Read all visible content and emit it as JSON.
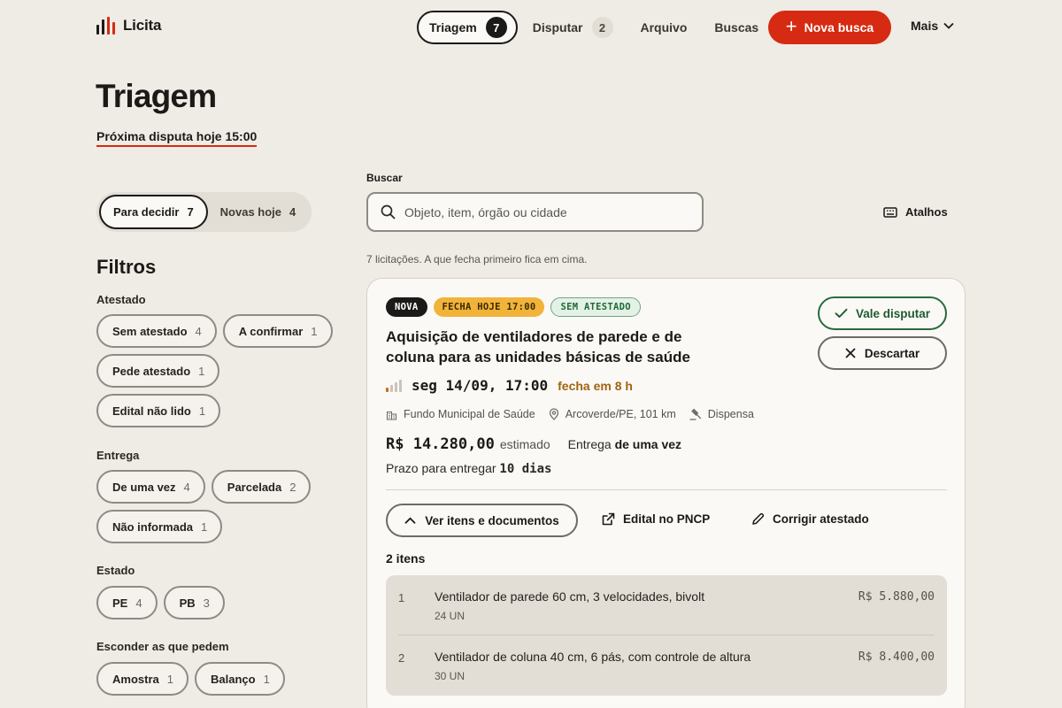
{
  "brand": {
    "name": "Licita",
    "icon": "bar-chart-icon"
  },
  "nav": {
    "items": [
      {
        "label": "Triagem",
        "count": "7",
        "active": true
      },
      {
        "label": "Disputar",
        "count": "2",
        "active": false
      },
      {
        "label": "Arquivo"
      },
      {
        "label": "Buscas"
      }
    ],
    "new_search": "Nova busca",
    "more": "Mais"
  },
  "page": {
    "title": "Triagem",
    "next_dispute": "Próxima disputa hoje 15:00"
  },
  "segment": [
    {
      "label": "Para decidir",
      "count": "7",
      "active": true
    },
    {
      "label": "Novas hoje",
      "count": "4",
      "active": false
    }
  ],
  "filters": {
    "title": "Filtros",
    "groups": [
      {
        "label": "Atestado",
        "chips": [
          {
            "label": "Sem atestado",
            "count": "4"
          },
          {
            "label": "A confirmar",
            "count": "1"
          },
          {
            "label": "Pede atestado",
            "count": "1"
          },
          {
            "label": "Edital não lido",
            "count": "1"
          }
        ]
      },
      {
        "label": "Entrega",
        "chips": [
          {
            "label": "De uma vez",
            "count": "4"
          },
          {
            "label": "Parcelada",
            "count": "2"
          },
          {
            "label": "Não informada",
            "count": "1"
          }
        ]
      },
      {
        "label": "Estado",
        "chips": [
          {
            "label": "PE",
            "count": "4"
          },
          {
            "label": "PB",
            "count": "3"
          }
        ]
      },
      {
        "label": "Esconder as que pedem",
        "chips": [
          {
            "label": "Amostra",
            "count": "1"
          },
          {
            "label": "Balanço",
            "count": "1"
          }
        ]
      }
    ]
  },
  "search": {
    "label": "Buscar",
    "placeholder": "Objeto, item, órgão ou cidade",
    "value": ""
  },
  "shortcuts": "Atalhos",
  "results_note": "7 licitações. A que fecha primeiro fica em cima.",
  "card": {
    "tags": [
      "NOVA",
      "FECHA HOJE 17:00",
      "SEM ATESTADO"
    ],
    "title": "Aquisição de ventiladores de parede e de coluna para as unidades básicas de saúde",
    "date": "seg 14/09, 17:00",
    "closes_in": "fecha em 8 h",
    "urgency_level": 1,
    "agency": "Fundo Municipal de Saúde",
    "location": "Arcoverde/PE, 101 km",
    "modality": "Dispensa",
    "value": "R$ 14.280,00",
    "value_suffix": "estimado",
    "delivery_label": "Entrega",
    "delivery_value": "de uma vez",
    "deadline_label": "Prazo para entregar",
    "deadline_value": "10 dias",
    "actions": {
      "accept": "Vale disputar",
      "discard": "Descartar",
      "items": "Ver itens e documentos",
      "notice": "Edital no PNCP",
      "fix": "Corrigir atestado"
    },
    "items_count": "2 itens",
    "items": [
      {
        "num": "1",
        "desc": "Ventilador de parede 60 cm, 3 velocidades, bivolt",
        "qty": "24 UN",
        "price": "R$ 5.880,00"
      },
      {
        "num": "2",
        "desc": "Ventilador de coluna 40 cm, 6 pás, com controle de altura",
        "qty": "30 UN",
        "price": "R$ 8.400,00"
      }
    ]
  },
  "colors": {
    "accent": "#d62a12",
    "background": "#efebe5",
    "success": "#2a6b3c",
    "warning": "#f2b33a"
  }
}
